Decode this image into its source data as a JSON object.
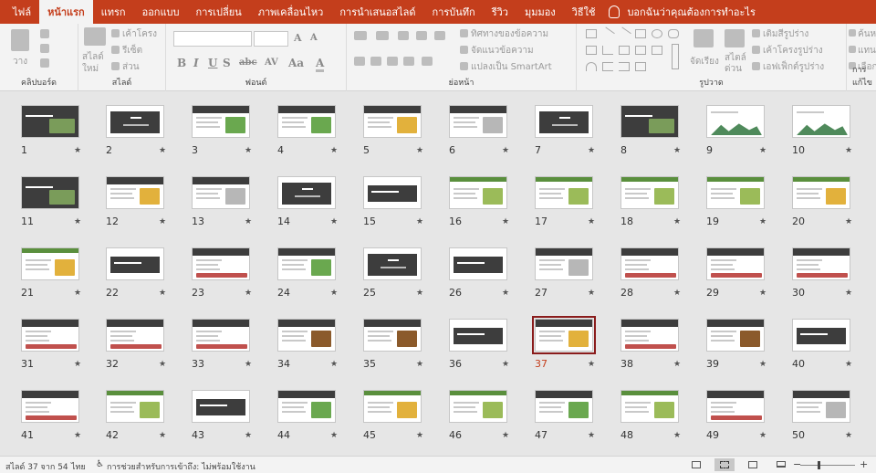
{
  "tabs": [
    {
      "label": "ไฟล์",
      "active": false
    },
    {
      "label": "หน้าแรก",
      "active": true
    },
    {
      "label": "แทรก",
      "active": false
    },
    {
      "label": "ออกแบบ",
      "active": false
    },
    {
      "label": "การเปลี่ยน",
      "active": false
    },
    {
      "label": "ภาพเคลื่อนไหว",
      "active": false
    },
    {
      "label": "การนำเสนอสไลด์",
      "active": false
    },
    {
      "label": "การบันทึก",
      "active": false
    },
    {
      "label": "รีวิว",
      "active": false
    },
    {
      "label": "มุมมอง",
      "active": false
    },
    {
      "label": "วิธีใช้",
      "active": false
    }
  ],
  "tell_me": "บอกฉันว่าคุณต้องการทำอะไร",
  "ribbon": {
    "clipboard": {
      "paste": "วาง",
      "label": "คลิปบอร์ด"
    },
    "slides": {
      "new_slide": "สไลด์",
      "new_slide_2": "ใหม่",
      "layout": "เค้าโครง",
      "reset": "รีเซ็ต",
      "section": "ส่วน",
      "label": "สไลด์"
    },
    "font": {
      "label": "ฟอนต์"
    },
    "paragraph": {
      "text_direction": "ทิศทางของข้อความ",
      "align_text": "จัดแนวข้อความ",
      "smartart": "แปลงเป็น SmartArt",
      "label": "ย่อหน้า"
    },
    "drawing": {
      "arrange": "จัดเรียง",
      "quick_styles": "สไตล์",
      "quick_styles_2": "ด่วน",
      "shape_fill": "เติมสีรูปร่าง",
      "shape_outline": "เค้าโครงรูปร่าง",
      "shape_effects": "เอฟเฟ็กต์รูปร่าง",
      "label": "รูปวาด"
    },
    "editing": {
      "find": "ค้นหา",
      "replace": "แทนที่",
      "select": "เลือก",
      "label": "การแก้ไข"
    }
  },
  "slides_total": 54,
  "selected_slide": "37",
  "slides": [
    {
      "n": "1",
      "style": "dark"
    },
    {
      "n": "2",
      "style": "section"
    },
    {
      "n": "3",
      "style": "pic-green"
    },
    {
      "n": "4",
      "style": "pic-green"
    },
    {
      "n": "5",
      "style": "pic-yellow"
    },
    {
      "n": "6",
      "style": "text"
    },
    {
      "n": "7",
      "style": "section"
    },
    {
      "n": "8",
      "style": "dark"
    },
    {
      "n": "9",
      "style": "mountain"
    },
    {
      "n": "10",
      "style": "mountain"
    },
    {
      "n": "11",
      "style": "dark"
    },
    {
      "n": "12",
      "style": "pic-yellow"
    },
    {
      "n": "13",
      "style": "text"
    },
    {
      "n": "14",
      "style": "section"
    },
    {
      "n": "15",
      "style": "band"
    },
    {
      "n": "16",
      "style": "green-text"
    },
    {
      "n": "17",
      "style": "green-text"
    },
    {
      "n": "18",
      "style": "green-text"
    },
    {
      "n": "19",
      "style": "green-text"
    },
    {
      "n": "20",
      "style": "green-pic"
    },
    {
      "n": "21",
      "style": "green-pic"
    },
    {
      "n": "22",
      "style": "band"
    },
    {
      "n": "23",
      "style": "pic-red"
    },
    {
      "n": "24",
      "style": "pic-green"
    },
    {
      "n": "25",
      "style": "section"
    },
    {
      "n": "26",
      "style": "band"
    },
    {
      "n": "27",
      "style": "text"
    },
    {
      "n": "28",
      "style": "pic-red"
    },
    {
      "n": "29",
      "style": "pic-red"
    },
    {
      "n": "30",
      "style": "pic-red"
    },
    {
      "n": "31",
      "style": "pic-red"
    },
    {
      "n": "32",
      "style": "pic-red"
    },
    {
      "n": "33",
      "style": "pic-red"
    },
    {
      "n": "34",
      "style": "pic-brown"
    },
    {
      "n": "35",
      "style": "pic-brown"
    },
    {
      "n": "36",
      "style": "band"
    },
    {
      "n": "37",
      "style": "pic-yellow"
    },
    {
      "n": "38",
      "style": "pic-red"
    },
    {
      "n": "39",
      "style": "pic-brown"
    },
    {
      "n": "40",
      "style": "band"
    },
    {
      "n": "41",
      "style": "pic-red"
    },
    {
      "n": "42",
      "style": "green-text"
    },
    {
      "n": "43",
      "style": "band"
    },
    {
      "n": "44",
      "style": "pic-green"
    },
    {
      "n": "45",
      "style": "green-pic"
    },
    {
      "n": "46",
      "style": "green-text"
    },
    {
      "n": "47",
      "style": "pic-green"
    },
    {
      "n": "48",
      "style": "green-text"
    },
    {
      "n": "49",
      "style": "pic-red"
    },
    {
      "n": "50",
      "style": "text"
    }
  ],
  "status": {
    "slide_info": "สไลด์ 37 จาก 54",
    "language": "ไทย",
    "accessibility": "การช่วยสำหรับการเข้าถึง: ไม่พร้อมใช้งาน"
  },
  "colors": {
    "accent": "#c43e1c",
    "selection": "#8a1c1c",
    "dark": "#3d3d3d",
    "green": "#5a8f3d"
  }
}
